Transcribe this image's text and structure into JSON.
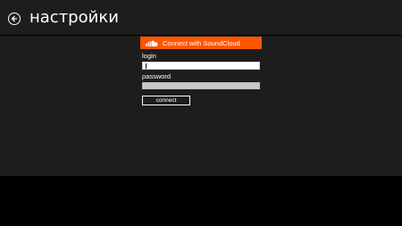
{
  "header": {
    "title": "настройки",
    "back_icon": "back-arrow-circle-icon"
  },
  "soundcloud": {
    "title": "Connect with SoundCloud",
    "logo_icon": "soundcloud-cloud-icon",
    "brand_color": "#ff5500"
  },
  "form": {
    "login_label": "login",
    "login_value": "",
    "password_label": "password",
    "password_value": "",
    "connect_label": "connect"
  },
  "colors": {
    "background": "#1d1d1d",
    "bottom_bar": "#000000"
  }
}
